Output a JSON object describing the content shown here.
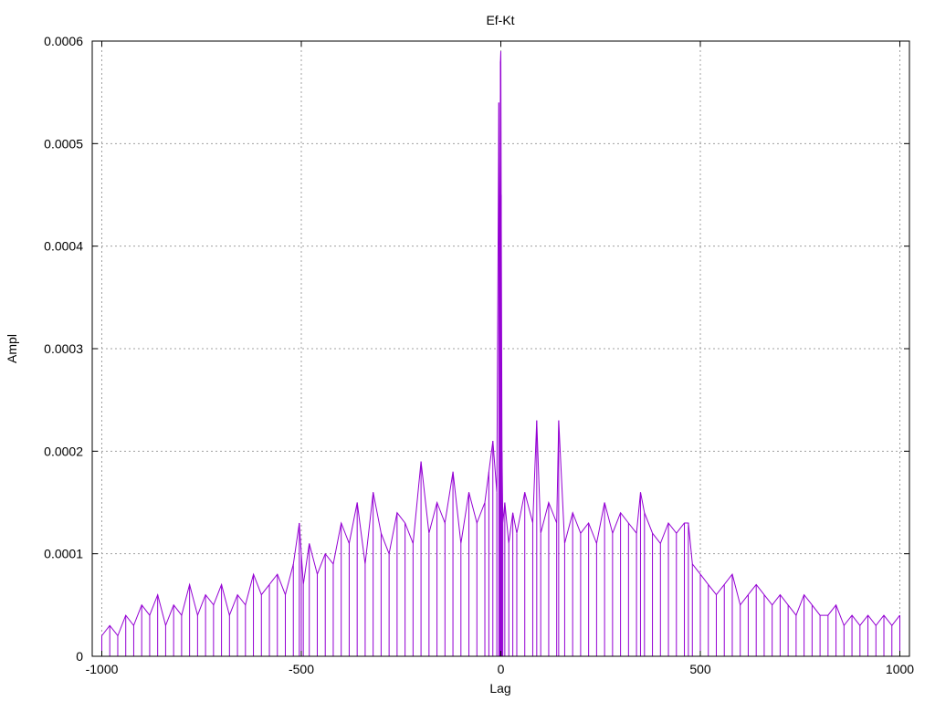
{
  "chart_data": {
    "type": "line",
    "title": "Ef-Kt",
    "xlabel": "Lag",
    "ylabel": "Ampl",
    "xlim": [
      -1024,
      1024
    ],
    "ylim": [
      0,
      0.0006
    ],
    "grid": true,
    "x_ticks": [
      -1000,
      -500,
      0,
      500,
      1000
    ],
    "x_tick_labels": [
      "-1000",
      "-500",
      "0",
      "500",
      "1000"
    ],
    "y_ticks": [
      0,
      0.0001,
      0.0002,
      0.0003,
      0.0004,
      0.0005,
      0.0006
    ],
    "y_tick_labels": [
      "0",
      "0.0001",
      "0.0002",
      "0.0003",
      "0.0004",
      "0.0005",
      "0.0006"
    ],
    "series": [
      {
        "color": "#9400d3",
        "x": [
          -1000,
          -980,
          -960,
          -940,
          -920,
          -900,
          -880,
          -860,
          -840,
          -820,
          -800,
          -780,
          -760,
          -740,
          -720,
          -700,
          -680,
          -660,
          -640,
          -620,
          -600,
          -580,
          -560,
          -540,
          -520,
          -505,
          -500,
          -495,
          -480,
          -460,
          -440,
          -420,
          -400,
          -380,
          -360,
          -340,
          -320,
          -300,
          -280,
          -260,
          -240,
          -220,
          -200,
          -180,
          -160,
          -140,
          -120,
          -100,
          -80,
          -60,
          -40,
          -30,
          -20,
          -10,
          -5,
          -3,
          -1,
          0,
          1,
          3,
          5,
          10,
          20,
          30,
          40,
          60,
          80,
          90,
          100,
          120,
          140,
          145,
          160,
          180,
          200,
          220,
          240,
          260,
          280,
          300,
          320,
          340,
          350,
          360,
          380,
          400,
          420,
          440,
          460,
          470,
          480,
          500,
          520,
          540,
          560,
          580,
          600,
          620,
          640,
          660,
          680,
          700,
          720,
          740,
          760,
          780,
          800,
          820,
          840,
          860,
          880,
          900,
          920,
          940,
          960,
          980,
          1000
        ],
        "y": [
          2e-05,
          3e-05,
          2e-05,
          4e-05,
          3e-05,
          5e-05,
          4e-05,
          6e-05,
          3e-05,
          5e-05,
          4e-05,
          7e-05,
          4e-05,
          6e-05,
          5e-05,
          7e-05,
          4e-05,
          6e-05,
          5e-05,
          8e-05,
          6e-05,
          7e-05,
          8e-05,
          6e-05,
          9e-05,
          0.00013,
          0.0001,
          7e-05,
          0.00011,
          8e-05,
          0.0001,
          9e-05,
          0.00013,
          0.00011,
          0.00015,
          9e-05,
          0.00016,
          0.00012,
          0.0001,
          0.00014,
          0.00013,
          0.00011,
          0.00019,
          0.00012,
          0.00015,
          0.00013,
          0.00018,
          0.00011,
          0.00016,
          0.00013,
          0.00015,
          0.00018,
          0.00021,
          0.00016,
          0.00054,
          0.0003,
          0.00058,
          0.00059,
          0.00045,
          0.0002,
          0.00013,
          0.00015,
          0.00011,
          0.00014,
          0.00012,
          0.00016,
          0.00013,
          0.00023,
          0.00012,
          0.00015,
          0.00013,
          0.00023,
          0.00011,
          0.00014,
          0.00012,
          0.00013,
          0.00011,
          0.00015,
          0.00012,
          0.00014,
          0.00013,
          0.00012,
          0.00016,
          0.00014,
          0.00012,
          0.00011,
          0.00013,
          0.00012,
          0.00013,
          0.00013,
          9e-05,
          8e-05,
          7e-05,
          6e-05,
          7e-05,
          8e-05,
          5e-05,
          6e-05,
          7e-05,
          6e-05,
          5e-05,
          6e-05,
          5e-05,
          4e-05,
          6e-05,
          5e-05,
          4e-05,
          4e-05,
          5e-05,
          3e-05,
          4e-05,
          3e-05,
          4e-05,
          3e-05,
          4e-05,
          3e-05,
          4e-05
        ]
      }
    ]
  }
}
